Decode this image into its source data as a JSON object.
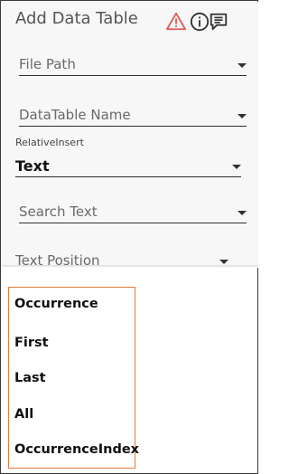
{
  "header": {
    "title": "Add Data Table",
    "icons": [
      "warning-icon",
      "info-icon",
      "comment-icon"
    ],
    "warning_color": "#e05a5a"
  },
  "fields": {
    "file_path": {
      "label": "File Path"
    },
    "datatable_name": {
      "label": "DataTable Name"
    },
    "relative_insert": {
      "caption": "RelativeInsert",
      "value": "Text"
    },
    "search_text": {
      "label": "Search Text"
    },
    "text_position": {
      "label": "Text Position"
    }
  },
  "options_panel": {
    "border_color": "#e07b39",
    "items": [
      {
        "label": "Occurrence"
      },
      {
        "label": "First"
      },
      {
        "label": "Last"
      },
      {
        "label": "All"
      },
      {
        "label": "OccurrenceIndex"
      }
    ]
  }
}
